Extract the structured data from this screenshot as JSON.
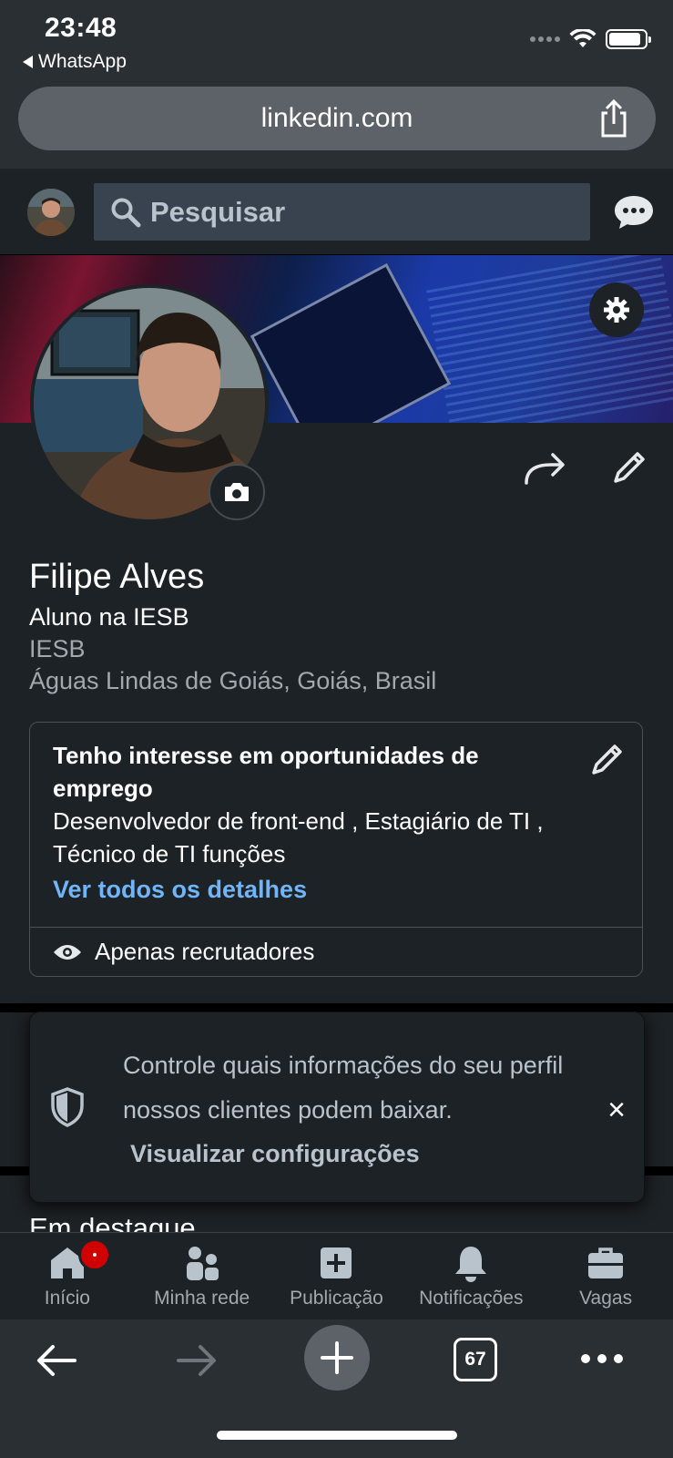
{
  "status_bar": {
    "time": "23:48",
    "back_app": "WhatsApp"
  },
  "browser": {
    "url": "linkedin.com",
    "tab_count": "67"
  },
  "header": {
    "search_placeholder": "Pesquisar"
  },
  "profile": {
    "name": "Filipe Alves",
    "headline": "Aluno na IESB",
    "company": "IESB",
    "location": "Águas Lindas de Goiás, Goiás, Brasil"
  },
  "open_to_work": {
    "title": "Tenho interesse em oportunidades de emprego",
    "description": "Desenvolvedor de front-end , Estagiário de TI , Técnico de TI funções",
    "link": "Ver todos os detalhes",
    "visibility": "Apenas recrutadores"
  },
  "toast": {
    "text": "Controle quais informações do seu perfil nossos clientes podem baixar.",
    "link": "Visualizar configurações",
    "close": "×"
  },
  "featured_heading": "Em destaque",
  "bottom_nav": {
    "items": [
      {
        "label": "Início",
        "icon": "home-icon"
      },
      {
        "label": "Minha rede",
        "icon": "network-icon"
      },
      {
        "label": "Publicação",
        "icon": "post-icon"
      },
      {
        "label": "Notificações",
        "icon": "bell-icon"
      },
      {
        "label": "Vagas",
        "icon": "briefcase-icon"
      }
    ]
  },
  "colors": {
    "background": "#1d2226",
    "link_blue": "#70b5f9",
    "muted_text": "#a2a8ad",
    "badge_red": "#d00000"
  }
}
